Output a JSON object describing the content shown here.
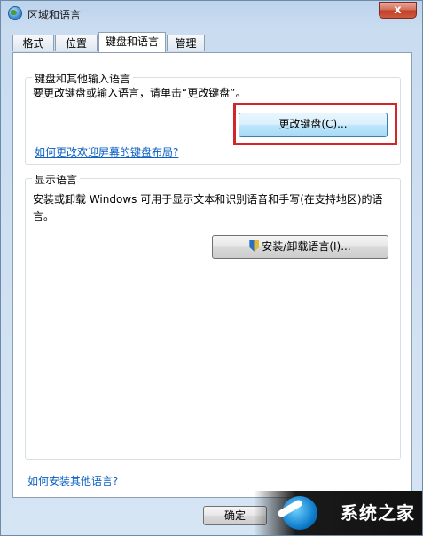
{
  "window": {
    "title": "区域和语言",
    "close_label": "x"
  },
  "tabs": [
    {
      "label": "格式"
    },
    {
      "label": "位置"
    },
    {
      "label": "键盘和语言",
      "active": true
    },
    {
      "label": "管理"
    }
  ],
  "keyboard_group": {
    "title": "键盘和其他输入语言",
    "description": "要更改键盘或输入语言，请单击“更改键盘”。",
    "change_button": "更改键盘(C)...",
    "link": "如何更改欢迎屏幕的键盘布局?"
  },
  "display_group": {
    "title": "显示语言",
    "description_line1": "安装或卸载 Windows 可用于显示文本和识别语音和手写(在支持地区)的语",
    "description_line2": "言。",
    "install_button": "安装/卸载语言(I)..."
  },
  "footer": {
    "link": "如何安装其他语言?",
    "ok_button": "确定"
  },
  "watermark": {
    "text": "系统之家"
  },
  "colors": {
    "highlight": "#d2262b",
    "link": "#0a5fc2"
  }
}
